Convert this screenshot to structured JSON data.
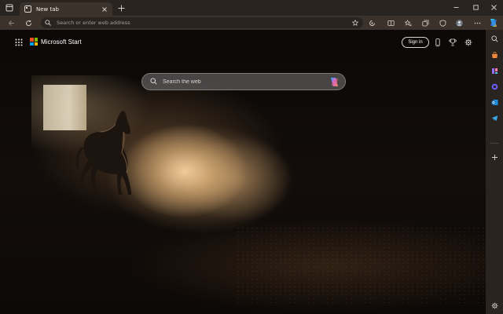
{
  "browser": {
    "tab": {
      "title": "New tab"
    },
    "address_bar": {
      "placeholder": "Search or enter web address",
      "value": ""
    }
  },
  "page": {
    "brand": "Microsoft Start",
    "sign_in_label": "Sign in",
    "search": {
      "placeholder": "Search the web",
      "value": ""
    }
  },
  "icons": {
    "tab_favicon": "new-tab-icon",
    "sidebar": [
      "copilot-icon",
      "search-icon",
      "shopping-icon",
      "tools-icon",
      "microsoft-365-icon",
      "outlook-icon",
      "telegram-icon",
      "add-icon",
      "settings-icon"
    ]
  },
  "colors": {
    "titlebar": "#2a2420",
    "toolbar": "#3b322b",
    "ms_logo": [
      "#f25022",
      "#7fba00",
      "#00a4ef",
      "#ffb900"
    ]
  }
}
